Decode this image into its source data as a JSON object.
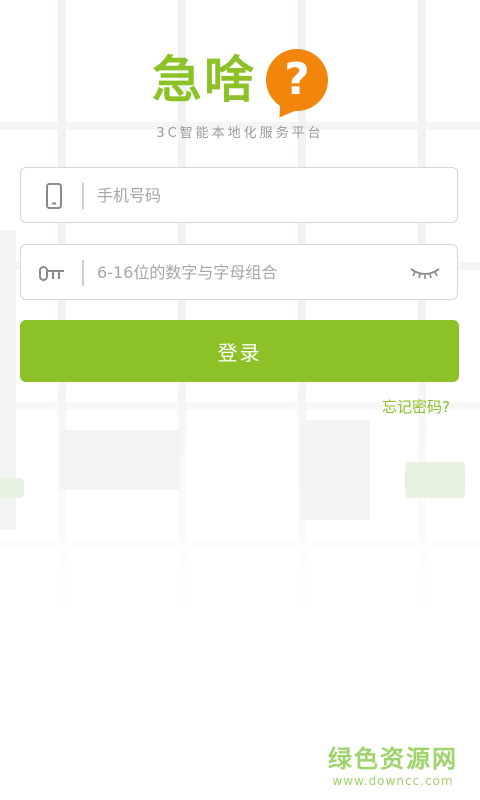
{
  "app": {
    "brand_name": "急啥",
    "slogan": "3C智能本地化服务平台",
    "logo_symbol": "?"
  },
  "form": {
    "phone": {
      "placeholder": "手机号码",
      "value": "",
      "icon": "phone-icon"
    },
    "password": {
      "placeholder": "6-16位的数字与字母组合",
      "value": "",
      "icon": "key-icon",
      "toggle_icon": "eye-closed-icon"
    },
    "login_label": "登录",
    "forgot_label": "忘记密码?"
  },
  "watermark": {
    "title": "绿色资源网",
    "url": "www.downcc.com"
  },
  "colors": {
    "brand_green": "#8cc228",
    "accent_orange": "#f2860c",
    "placeholder_gray": "#a6a6a6",
    "border_gray": "#d6d6d6",
    "watermark_green": "#9fd36b"
  }
}
